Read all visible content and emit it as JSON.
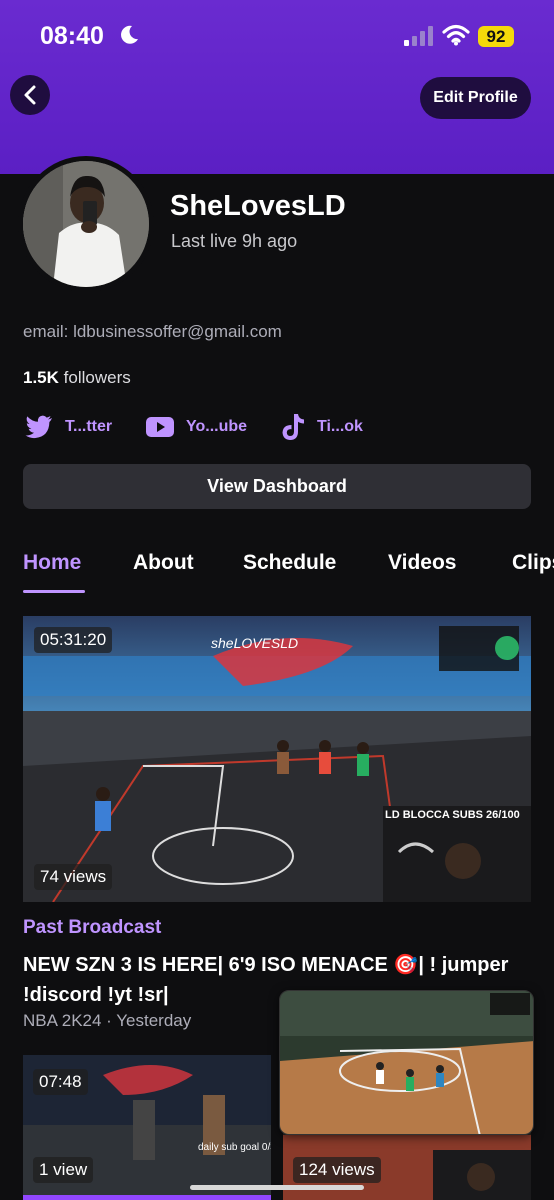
{
  "status_bar": {
    "time": "08:40",
    "battery": "92"
  },
  "header": {
    "edit_profile_label": "Edit Profile"
  },
  "profile": {
    "channel_name": "SheLovesLD",
    "last_live": "Last live 9h ago",
    "email": "email: ldbusinessoffer@gmail.com",
    "followers_count": "1.5K",
    "followers_label": " followers"
  },
  "socials": [
    {
      "icon": "twitter-icon",
      "label": "T...tter"
    },
    {
      "icon": "youtube-icon",
      "label": "Yo...ube"
    },
    {
      "icon": "tiktok-icon",
      "label": "Ti...ok"
    }
  ],
  "dashboard_label": "View Dashboard",
  "tabs": [
    "Home",
    "About",
    "Schedule",
    "Videos",
    "Clips"
  ],
  "active_tab": "Home",
  "featured_video": {
    "duration": "05:31:20",
    "views": "74 views",
    "overlay_text": "LD BLOCCA SUBS 26/100",
    "tag": "Past Broadcast",
    "title": "NEW SZN 3 IS HERE| 6'9 ISO MENACE 🎯| ! jumper !discord !yt !sr|",
    "meta": "NBA 2K24 · Yesterday"
  },
  "videos": [
    {
      "duration": "07:48",
      "views": "1 view"
    },
    {
      "views": "124 views"
    }
  ],
  "colors": {
    "accent": "#bf94ff",
    "header": "#5b1fc4",
    "background": "#0e0e10"
  }
}
